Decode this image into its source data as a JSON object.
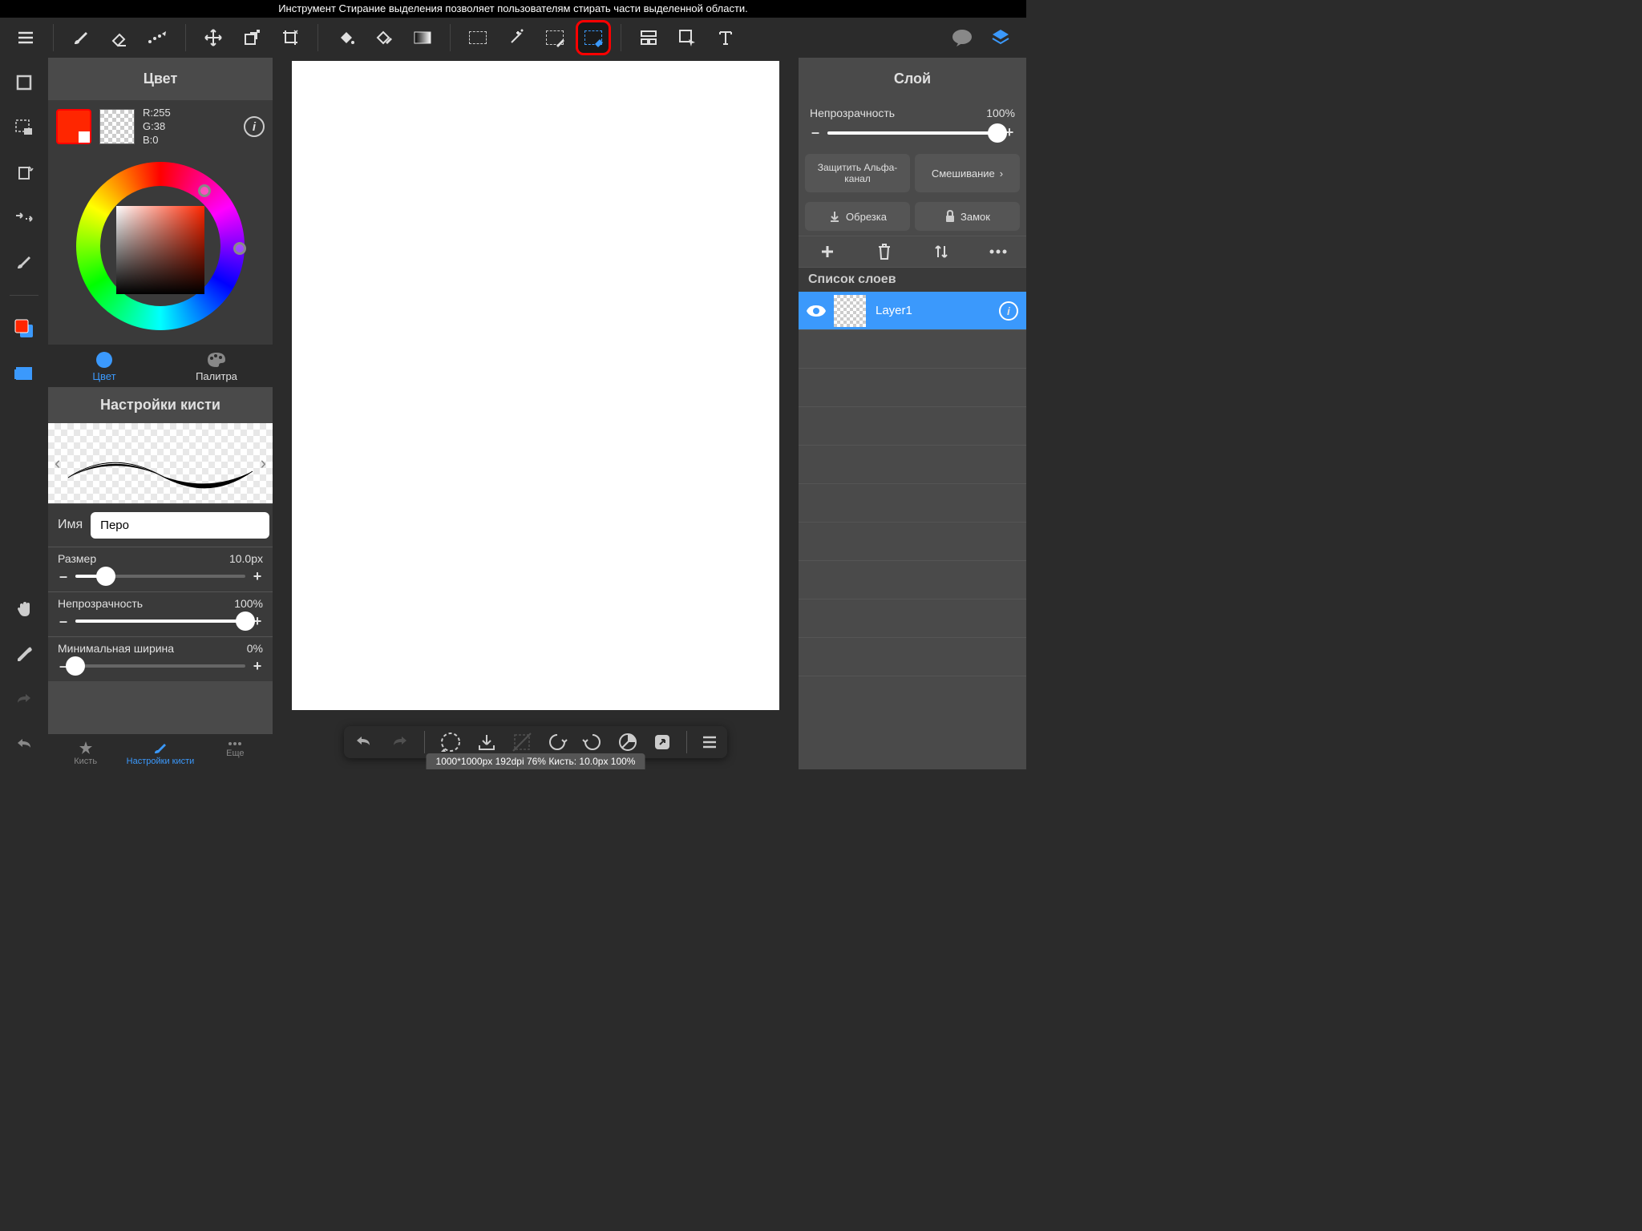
{
  "tooltip": "Инструмент Стирание выделения позволяет пользователям стирать части выделенной области.",
  "color_panel": {
    "title": "Цвет",
    "rgb": {
      "r": "R:255",
      "g": "G:38",
      "b": "B:0"
    },
    "tab_color": "Цвет",
    "tab_palette": "Палитра"
  },
  "brush_panel": {
    "title": "Настройки кисти",
    "name_label": "Имя",
    "name_value": "Перо",
    "size_label": "Размер",
    "size_value": "10.0px",
    "opacity_label": "Непрозрачность",
    "opacity_value": "100%",
    "minwidth_label": "Минимальная ширина",
    "minwidth_value": "0%"
  },
  "bottom_tabs": {
    "brush": "Кисть",
    "settings": "Настройки кисти",
    "more": "Еще"
  },
  "layer_panel": {
    "title": "Слой",
    "opacity_label": "Непрозрачность",
    "opacity_value": "100%",
    "protect_alpha": "Защитить Альфа-канал",
    "blend": "Смешивание",
    "crop": "Обрезка",
    "lock": "Замок",
    "list_title": "Список слоев",
    "layer1": "Layer1"
  },
  "status": "1000*1000px 192dpi 76% Кисть: 10.0px 100%",
  "minus": "–",
  "plus": "+"
}
